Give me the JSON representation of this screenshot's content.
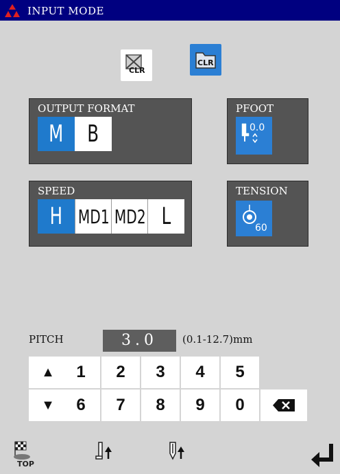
{
  "window": {
    "title": "INPUT MODE"
  },
  "clear_buttons": [
    {
      "label": "CLR",
      "icon": "clear-disabled-icon"
    },
    {
      "label": "CLR",
      "icon": "clear-folder-icon"
    }
  ],
  "output_format": {
    "title": "OUTPUT FORMAT",
    "options": [
      "M",
      "B"
    ],
    "selected": "M"
  },
  "pfoot": {
    "title": "PFOOT",
    "value": "0.0",
    "icon": "presser-foot-icon"
  },
  "speed": {
    "title": "SPEED",
    "options": [
      "H",
      "MD1",
      "MD2",
      "L"
    ],
    "selected": "H"
  },
  "tension": {
    "title": "TENSION",
    "value": "60",
    "icon": "thread-tension-icon"
  },
  "pitch": {
    "label": "PITCH",
    "value": "3.0",
    "range": "(0.1-12.7)mm"
  },
  "keypad": {
    "row1": [
      "1",
      "2",
      "3",
      "4",
      "5"
    ],
    "row2": [
      "6",
      "7",
      "8",
      "9",
      "0"
    ],
    "up": "▲",
    "down": "▼",
    "backspace": "backspace-icon"
  },
  "bottom_bar": {
    "top_label": "TOP",
    "icons": [
      "top-flag-icon",
      "needle-up-icon",
      "presser-up-icon",
      "enter-icon"
    ]
  },
  "colors": {
    "titlebar": "#000080",
    "accent": "#2b7fd4",
    "panel": "#545454"
  }
}
